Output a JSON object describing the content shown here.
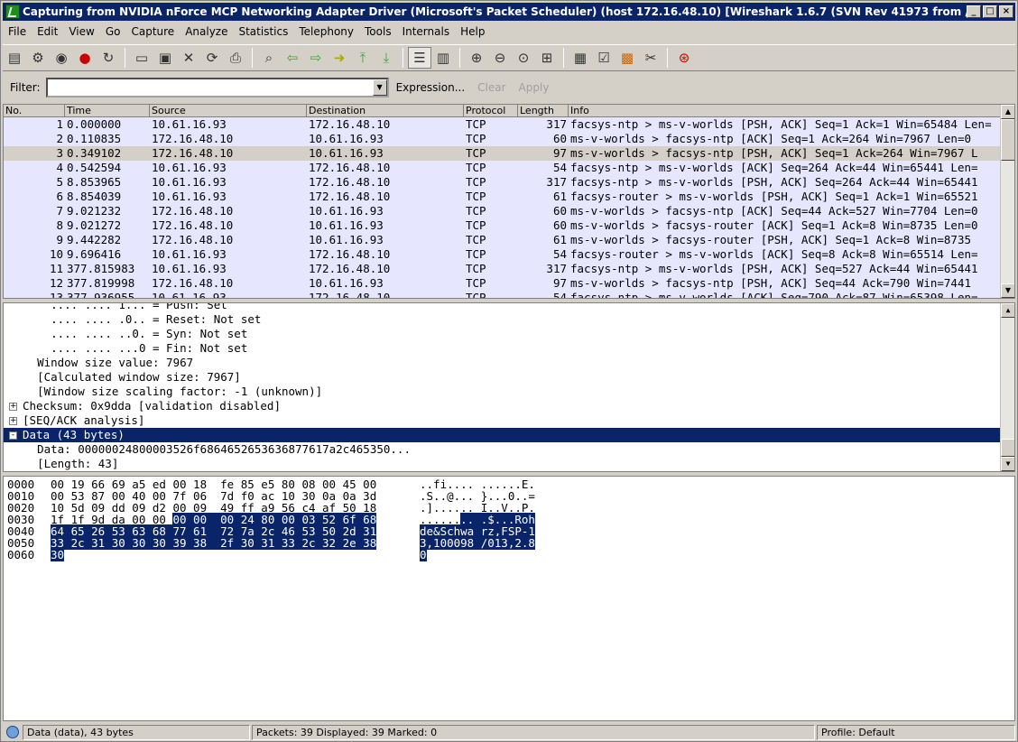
{
  "window": {
    "title": "Capturing from NVIDIA nForce MCP Networking Adapter Driver (Microsoft's Packet Scheduler)  (host 172.16.48.10)   [Wireshark 1.6.7  (SVN Rev 41973 from /trunk-1.6)]"
  },
  "menu": [
    "File",
    "Edit",
    "View",
    "Go",
    "Capture",
    "Analyze",
    "Statistics",
    "Telephony",
    "Tools",
    "Internals",
    "Help"
  ],
  "filter": {
    "label": "Filter:",
    "value": "",
    "expression": "Expression...",
    "clear": "Clear",
    "apply": "Apply"
  },
  "columns": [
    "No.",
    "Time",
    "Source",
    "Destination",
    "Protocol",
    "Length",
    "Info"
  ],
  "packets": [
    {
      "no": "1",
      "time": "0.000000",
      "src": "10.61.16.93",
      "dst": "172.16.48.10",
      "proto": "TCP",
      "len": "317",
      "info": "facsys-ntp > ms-v-worlds [PSH, ACK] Seq=1 Ack=1 Win=65484 Len="
    },
    {
      "no": "2",
      "time": "0.110835",
      "src": "172.16.48.10",
      "dst": "10.61.16.93",
      "proto": "TCP",
      "len": "60",
      "info": "ms-v-worlds > facsys-ntp [ACK] Seq=1 Ack=264 Win=7967 Len=0"
    },
    {
      "no": "3",
      "time": "0.349102",
      "src": "172.16.48.10",
      "dst": "10.61.16.93",
      "proto": "TCP",
      "len": "97",
      "info": "ms-v-worlds > facsys-ntp [PSH, ACK] Seq=1 Ack=264 Win=7967 L"
    },
    {
      "no": "4",
      "time": "0.542594",
      "src": "10.61.16.93",
      "dst": "172.16.48.10",
      "proto": "TCP",
      "len": "54",
      "info": "facsys-ntp > ms-v-worlds [ACK] Seq=264 Ack=44 Win=65441 Len="
    },
    {
      "no": "5",
      "time": "8.853965",
      "src": "10.61.16.93",
      "dst": "172.16.48.10",
      "proto": "TCP",
      "len": "317",
      "info": "facsys-ntp > ms-v-worlds [PSH, ACK] Seq=264 Ack=44 Win=65441"
    },
    {
      "no": "6",
      "time": "8.854039",
      "src": "10.61.16.93",
      "dst": "172.16.48.10",
      "proto": "TCP",
      "len": "61",
      "info": "facsys-router > ms-v-worlds [PSH, ACK] Seq=1 Ack=1 Win=65521"
    },
    {
      "no": "7",
      "time": "9.021232",
      "src": "172.16.48.10",
      "dst": "10.61.16.93",
      "proto": "TCP",
      "len": "60",
      "info": "ms-v-worlds > facsys-ntp [ACK] Seq=44 Ack=527 Win=7704 Len=0"
    },
    {
      "no": "8",
      "time": "9.021272",
      "src": "172.16.48.10",
      "dst": "10.61.16.93",
      "proto": "TCP",
      "len": "60",
      "info": "ms-v-worlds > facsys-router [ACK] Seq=1 Ack=8 Win=8735 Len=0"
    },
    {
      "no": "9",
      "time": "9.442282",
      "src": "172.16.48.10",
      "dst": "10.61.16.93",
      "proto": "TCP",
      "len": "61",
      "info": "ms-v-worlds > facsys-router [PSH, ACK] Seq=1 Ack=8 Win=8735"
    },
    {
      "no": "10",
      "time": "9.696416",
      "src": "10.61.16.93",
      "dst": "172.16.48.10",
      "proto": "TCP",
      "len": "54",
      "info": "facsys-router > ms-v-worlds [ACK] Seq=8 Ack=8 Win=65514 Len="
    },
    {
      "no": "11",
      "time": "377.815983",
      "src": "10.61.16.93",
      "dst": "172.16.48.10",
      "proto": "TCP",
      "len": "317",
      "info": "facsys-ntp > ms-v-worlds [PSH, ACK] Seq=527 Ack=44 Win=65441"
    },
    {
      "no": "12",
      "time": "377.819998",
      "src": "172.16.48.10",
      "dst": "10.61.16.93",
      "proto": "TCP",
      "len": "97",
      "info": "ms-v-worlds > facsys-ntp [PSH, ACK] Seq=44 Ack=790 Win=7441"
    },
    {
      "no": "13",
      "time": "377.936955",
      "src": "10.61.16.93",
      "dst": "172.16.48.10",
      "proto": "TCP",
      "len": "54",
      "info": "facsys-ntp > ms-v-worlds [ACK] Seq=790 Ack=87 Win=65398 Len="
    }
  ],
  "row_colors": {
    "tcp": "#e7e6ff",
    "selected": "#d4d0c8"
  },
  "details": [
    {
      "indent": "    ",
      "text": ".... .... 1... = Push: Set",
      "expander": ""
    },
    {
      "indent": "    ",
      "text": ".... .... .0.. = Reset: Not set",
      "expander": ""
    },
    {
      "indent": "    ",
      "text": ".... .... ..0. = Syn: Not set",
      "expander": ""
    },
    {
      "indent": "    ",
      "text": ".... .... ...0 = Fin: Not set",
      "expander": ""
    },
    {
      "indent": "  ",
      "text": "Window size value: 7967",
      "expander": ""
    },
    {
      "indent": "  ",
      "text": "[Calculated window size: 7967]",
      "expander": ""
    },
    {
      "indent": "  ",
      "text": "[Window size scaling factor: -1 (unknown)]",
      "expander": ""
    },
    {
      "indent": "",
      "text": "Checksum: 0x9dda [validation disabled]",
      "expander": "+"
    },
    {
      "indent": "",
      "text": "[SEQ/ACK analysis]",
      "expander": "+"
    },
    {
      "indent": "",
      "text": "Data (43 bytes)",
      "expander": "-"
    },
    {
      "indent": "  ",
      "text": "Data: 00000024800003526f6864652653636877617a2c465350...",
      "expander": ""
    },
    {
      "indent": "  ",
      "text": "[Length: 43]",
      "expander": ""
    }
  ],
  "hex": [
    {
      "off": "0000",
      "pre": "00 19 66 69 a5 ed 00 18  fe 85 e5 80 08 00 45 00",
      "hi": "",
      "asciipre": "..fi.... ......E.",
      "asciihi": ""
    },
    {
      "off": "0010",
      "pre": "00 53 87 00 40 00 7f 06  7d f0 ac 10 30 0a 0a 3d",
      "hi": "",
      "asciipre": ".S..@... }...0..=",
      "asciihi": ""
    },
    {
      "off": "0020",
      "pre": "10 5d 09 dd 09 d2 00 09  49 ff a9 56 c4 af 50 18",
      "hi": "",
      "asciipre": ".]...... I..V..P.",
      "asciihi": ""
    },
    {
      "off": "0030",
      "pre": "1f 1f 9d da 00 00 ",
      "hi": "00 00  00 24 80 00 03 52 6f 68",
      "asciipre": "......",
      "asciihi": ".. .$...Roh"
    },
    {
      "off": "0040",
      "pre": "",
      "hi": "64 65 26 53 63 68 77 61  72 7a 2c 46 53 50 2d 31",
      "asciipre": "",
      "asciihi": "de&Schwa rz,FSP-1"
    },
    {
      "off": "0050",
      "pre": "",
      "hi": "33 2c 31 30 30 30 39 38  2f 30 31 33 2c 32 2e 38",
      "asciipre": "",
      "asciihi": "3,100098 /013,2.8"
    },
    {
      "off": "0060",
      "pre": "",
      "hi": "30",
      "asciipre": "",
      "asciihi": "0"
    }
  ],
  "status": {
    "left": "Data (data), 43 bytes",
    "middle": "Packets: 39 Displayed: 39 Marked: 0",
    "right": "Profile: Default"
  }
}
